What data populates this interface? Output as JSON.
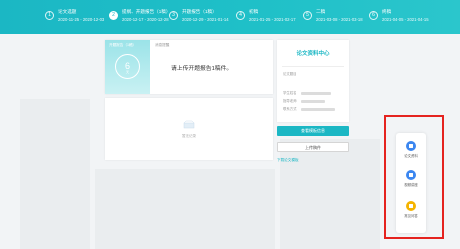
{
  "steps": [
    {
      "num": "1",
      "title": "论文选题",
      "dates": "2020-11-25 - 2020-12-03"
    },
    {
      "num": "2",
      "title": "提纲、开题报告（1稿）",
      "dates": "2020-12-17 - 2020-12-28"
    },
    {
      "num": "3",
      "title": "开题报告（1稿）",
      "dates": "2020-12-29 - 2021-01-14"
    },
    {
      "num": "4",
      "title": "初稿",
      "dates": "2021-01-25 - 2021-02-17"
    },
    {
      "num": "5",
      "title": "二稿",
      "dates": "2021-03-08 - 2021-03-18"
    },
    {
      "num": "6",
      "title": "终稿",
      "dates": "2021-04-05 - 2021-04-15"
    }
  ],
  "status": {
    "label": "开题报告（1稿）",
    "count": "6",
    "count_sub": "天"
  },
  "message": {
    "label": "消息提醒",
    "text": "请上传开题报告1稿件。"
  },
  "empty": {
    "text": "暂无记录"
  },
  "info": {
    "title": "论文资料中心",
    "section": "论文题目",
    "rows": [
      {
        "label": "学生姓名"
      },
      {
        "label": "指导老师"
      },
      {
        "label": "联系方式"
      }
    ]
  },
  "actions": {
    "primary": "查看模板信息",
    "upload": "上传稿件",
    "download": "下载论文模板"
  },
  "side_panel": [
    {
      "label": "论文资料",
      "color": "#3b86f0",
      "icon": "document-icon"
    },
    {
      "label": "视频讲座",
      "color": "#3b86f0",
      "icon": "video-icon"
    },
    {
      "label": "常见问答",
      "color": "#f5b400",
      "icon": "faq-icon"
    }
  ]
}
